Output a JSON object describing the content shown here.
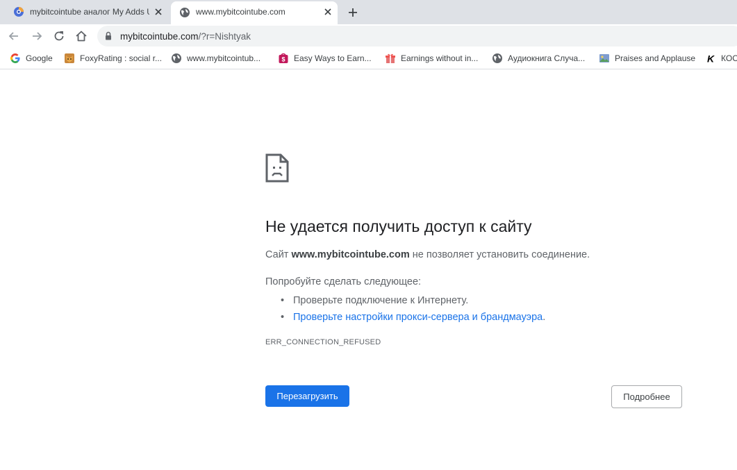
{
  "tabs": [
    {
      "title": "mybitcointube аналог My Adds U",
      "favicon": "firefox-style-icon",
      "active": false
    },
    {
      "title": "www.mybitcointube.com",
      "favicon": "globe-icon",
      "active": true
    }
  ],
  "toolbar": {
    "url_host": "mybitcointube.com",
    "url_path": "/?r=Nishtyak"
  },
  "bookmarks": [
    {
      "label": "Google",
      "icon": "google-icon"
    },
    {
      "label": "FoxyRating : social r...",
      "icon": "foxyrating-icon"
    },
    {
      "label": "www.mybitcointub...",
      "icon": "globe-icon"
    },
    {
      "label": "Easy Ways to Earn...",
      "icon": "dollar-bag-icon"
    },
    {
      "label": "Earnings without in...",
      "icon": "gift-icon"
    },
    {
      "label": "Аудиокнига Случа...",
      "icon": "globe-icon"
    },
    {
      "label": "Praises and Applause",
      "icon": "picture-icon"
    },
    {
      "label": "КОС",
      "icon": "k-icon"
    }
  ],
  "error": {
    "title": "Не удается получить доступ к сайту",
    "desc_prefix": "Сайт ",
    "desc_host": "www.mybitcointube.com",
    "desc_suffix": " не позволяет установить соединение.",
    "try_label": "Попробуйте сделать следующее:",
    "suggestion_1": "Проверьте подключение к Интернету.",
    "suggestion_2_link": "Проверьте настройки прокси-сервера и брандмауэра",
    "suggestion_2_end": ".",
    "code": "ERR_CONNECTION_REFUSED",
    "reload_label": "Перезагрузить",
    "details_label": "Подробнее"
  },
  "colors": {
    "accent": "#1a73e8",
    "tabstrip": "#dee1e6",
    "omnibox": "#f1f3f4"
  }
}
